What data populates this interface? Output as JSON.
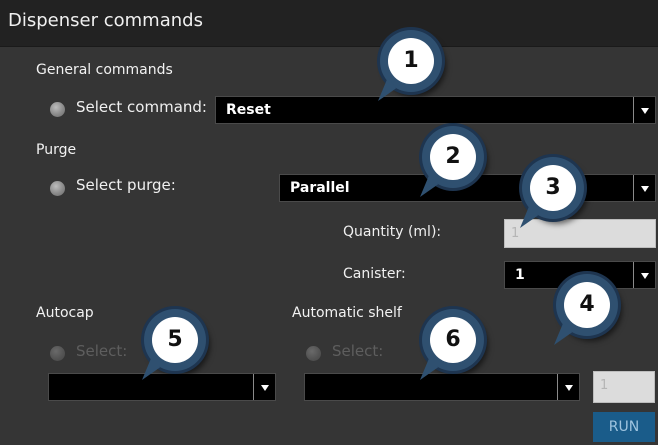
{
  "window": {
    "title": "Dispenser commands"
  },
  "general": {
    "label": "General commands",
    "select_label": "Select command:",
    "value": "Reset"
  },
  "purge": {
    "label": "Purge",
    "select_label": "Select purge:",
    "value": "Parallel",
    "quantity_label": "Quantity (ml):",
    "quantity_value": "1",
    "canister_label": "Canister:",
    "canister_value": "1"
  },
  "autocap": {
    "label": "Autocap",
    "select_label": "Select:",
    "value": ""
  },
  "shelf": {
    "label": "Automatic shelf",
    "select_label": "Select:",
    "value": "",
    "number_value": "1"
  },
  "run_label": "RUN",
  "callouts": [
    "1",
    "2",
    "3",
    "4",
    "5",
    "6"
  ],
  "colors": {
    "background": "#353535",
    "titlebar": "#222222",
    "run_button": "#1a5c8a",
    "callout_ring": "#2f5070"
  }
}
